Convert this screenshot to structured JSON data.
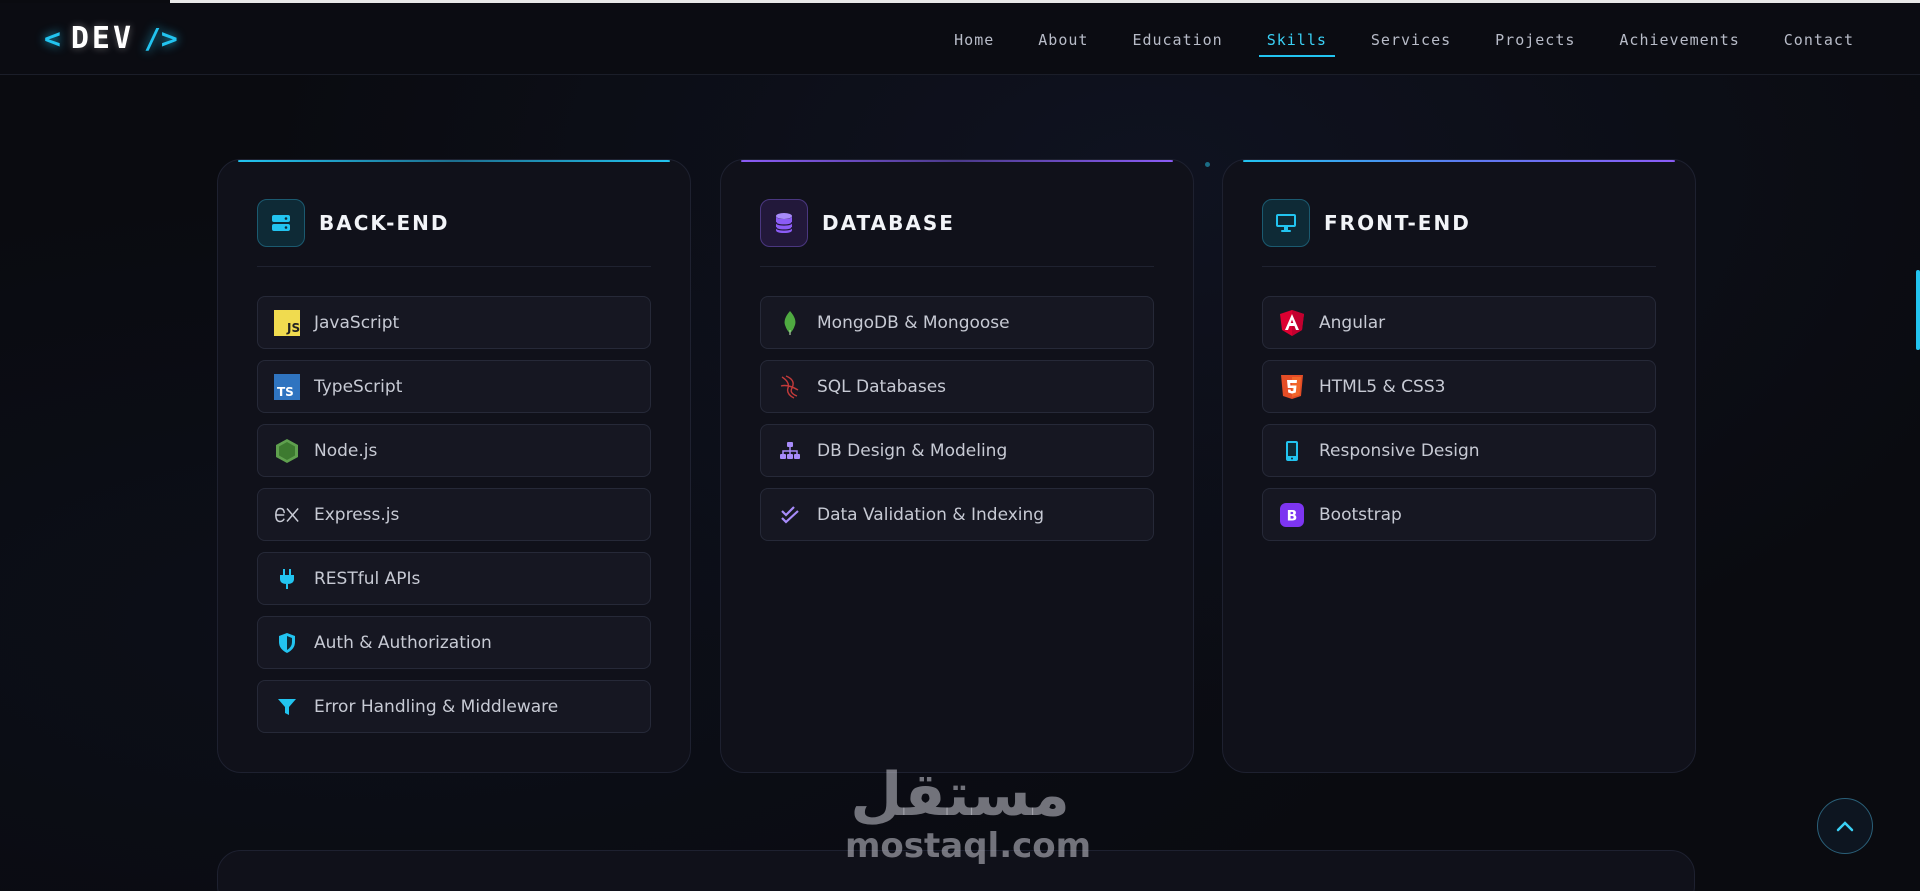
{
  "brand": {
    "open": "<",
    "word": "DEV",
    "close": "/>"
  },
  "nav": [
    {
      "label": "Home",
      "active": false
    },
    {
      "label": "About",
      "active": false
    },
    {
      "label": "Education",
      "active": false
    },
    {
      "label": "Skills",
      "active": true
    },
    {
      "label": "Services",
      "active": false
    },
    {
      "label": "Projects",
      "active": false
    },
    {
      "label": "Achievements",
      "active": false
    },
    {
      "label": "Contact",
      "active": false
    }
  ],
  "colors": {
    "accent_cyan": "#22c4f0",
    "accent_purple": "#8b5cf6",
    "card_bg": "#10111a",
    "page_bg": "#0a0b10"
  },
  "cards": [
    {
      "title": "BACK-END",
      "icon": "server-icon",
      "skills": [
        {
          "label": "JavaScript",
          "icon": "javascript-icon"
        },
        {
          "label": "TypeScript",
          "icon": "typescript-icon"
        },
        {
          "label": "Node.js",
          "icon": "nodejs-icon"
        },
        {
          "label": "Express.js",
          "icon": "express-icon"
        },
        {
          "label": "RESTful APIs",
          "icon": "plug-icon"
        },
        {
          "label": "Auth & Authorization",
          "icon": "shield-icon"
        },
        {
          "label": "Error Handling & Middleware",
          "icon": "filter-icon"
        }
      ]
    },
    {
      "title": "DATABASE",
      "icon": "database-icon",
      "skills": [
        {
          "label": "MongoDB & Mongoose",
          "icon": "mongodb-leaf-icon"
        },
        {
          "label": "SQL Databases",
          "icon": "sql-server-icon"
        },
        {
          "label": "DB Design & Modeling",
          "icon": "sitemap-icon"
        },
        {
          "label": "Data Validation & Indexing",
          "icon": "double-check-icon"
        }
      ]
    },
    {
      "title": "FRONT-END",
      "icon": "desktop-icon",
      "skills": [
        {
          "label": "Angular",
          "icon": "angular-icon"
        },
        {
          "label": "HTML5 & CSS3",
          "icon": "html5-icon"
        },
        {
          "label": "Responsive Design",
          "icon": "mobile-icon"
        },
        {
          "label": "Bootstrap",
          "icon": "bootstrap-icon"
        }
      ]
    }
  ],
  "watermark": {
    "arabic": "مستقل",
    "latin": "mostaql.com"
  }
}
